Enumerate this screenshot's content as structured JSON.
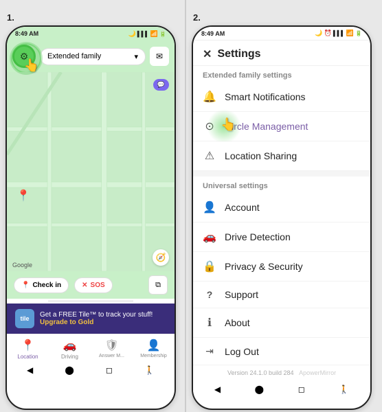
{
  "step1": {
    "label": "1.",
    "statusBar": {
      "time": "8:49 AM",
      "battery": "▪",
      "signal": "📶"
    },
    "topBar": {
      "dropdown": "Extended family",
      "dropdownIcon": "▾"
    },
    "map": {
      "googleLabel": "Google",
      "locationPin": "📍"
    },
    "actionBar": {
      "checkin": "Check in",
      "sos": "SOS",
      "checkinIcon": "📍",
      "sosIcon": "✕"
    },
    "promo": {
      "tileLabel": "tile",
      "text": "Get a FREE Tile™ to track your stuff!",
      "upgradeText": "Upgrade to Gold"
    },
    "navItems": [
      {
        "icon": "📍",
        "label": "Location",
        "active": true
      },
      {
        "icon": "🚗",
        "label": "Driving",
        "active": false
      },
      {
        "icon": "🛡",
        "label": "Answer M...",
        "active": false
      },
      {
        "icon": "👤",
        "label": "Membership",
        "active": false
      }
    ]
  },
  "step2": {
    "label": "2.",
    "statusBar": {
      "time": "8:49 AM"
    },
    "header": {
      "closeIcon": "✕",
      "title": "Settings"
    },
    "familySection": {
      "title": "Extended family settings",
      "items": [
        {
          "icon": "🔔",
          "label": "Smart Notifications"
        },
        {
          "icon": "⊙",
          "label": "Circle Management"
        },
        {
          "icon": "⚠",
          "label": "Location Sharing"
        }
      ]
    },
    "universalSection": {
      "title": "Universal settings",
      "items": [
        {
          "icon": "👤",
          "label": "Account"
        },
        {
          "icon": "🚗",
          "label": "Drive Detection"
        },
        {
          "icon": "🔒",
          "label": "Privacy & Security"
        },
        {
          "icon": "?",
          "label": "Support"
        },
        {
          "icon": "ℹ",
          "label": "About"
        },
        {
          "icon": "→",
          "label": "Log Out"
        }
      ]
    },
    "version": "Version 24.1.0 build 284",
    "watermark": "ApowerMirror"
  }
}
